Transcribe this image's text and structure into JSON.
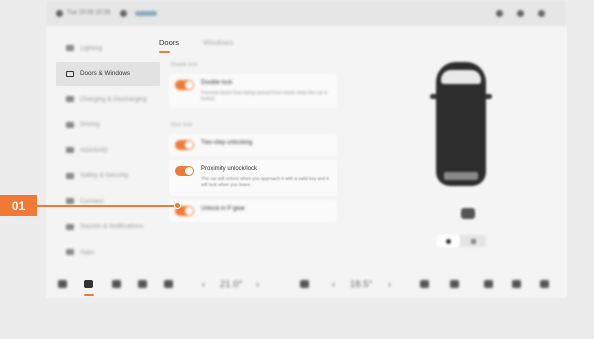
{
  "status_bar": {
    "left_text": "Tue 15:06 10:36",
    "items": [
      "",
      "",
      "",
      "",
      ""
    ]
  },
  "sidebar": {
    "items": [
      {
        "label": "Lighting"
      },
      {
        "label": "Doors & Windows"
      },
      {
        "label": "Charging & Discharging"
      },
      {
        "label": "Driving"
      },
      {
        "label": "ADAS/AD"
      },
      {
        "label": "Safety & Security"
      },
      {
        "label": "Connect"
      },
      {
        "label": "Sounds & Notifications"
      },
      {
        "label": "Apps"
      }
    ]
  },
  "tabs": [
    {
      "label": "Doors"
    },
    {
      "label": "Windows"
    }
  ],
  "sections": {
    "top_label": "Double lock",
    "mid_label": "Door lock"
  },
  "cards": {
    "double_lock": {
      "title": "Double lock",
      "desc": "Prevents doors from being opened from inside when the car is locked."
    },
    "two_step": {
      "title": "Two-step unlocking",
      "desc": ""
    },
    "proximity": {
      "title": "Proximity unlock/lock",
      "desc": "The car will unlock when you approach it with a valid key and it will lock when you leave."
    },
    "unlock_p": {
      "title": "Unlock in P gear",
      "desc": ""
    }
  },
  "dock": {
    "left_temp": "21.0°",
    "right_temp": "18.5°"
  },
  "callout": {
    "number": "01"
  },
  "colors": {
    "accent": "#f07a35",
    "background": "#ececec",
    "screen": "#f4f4f4"
  }
}
